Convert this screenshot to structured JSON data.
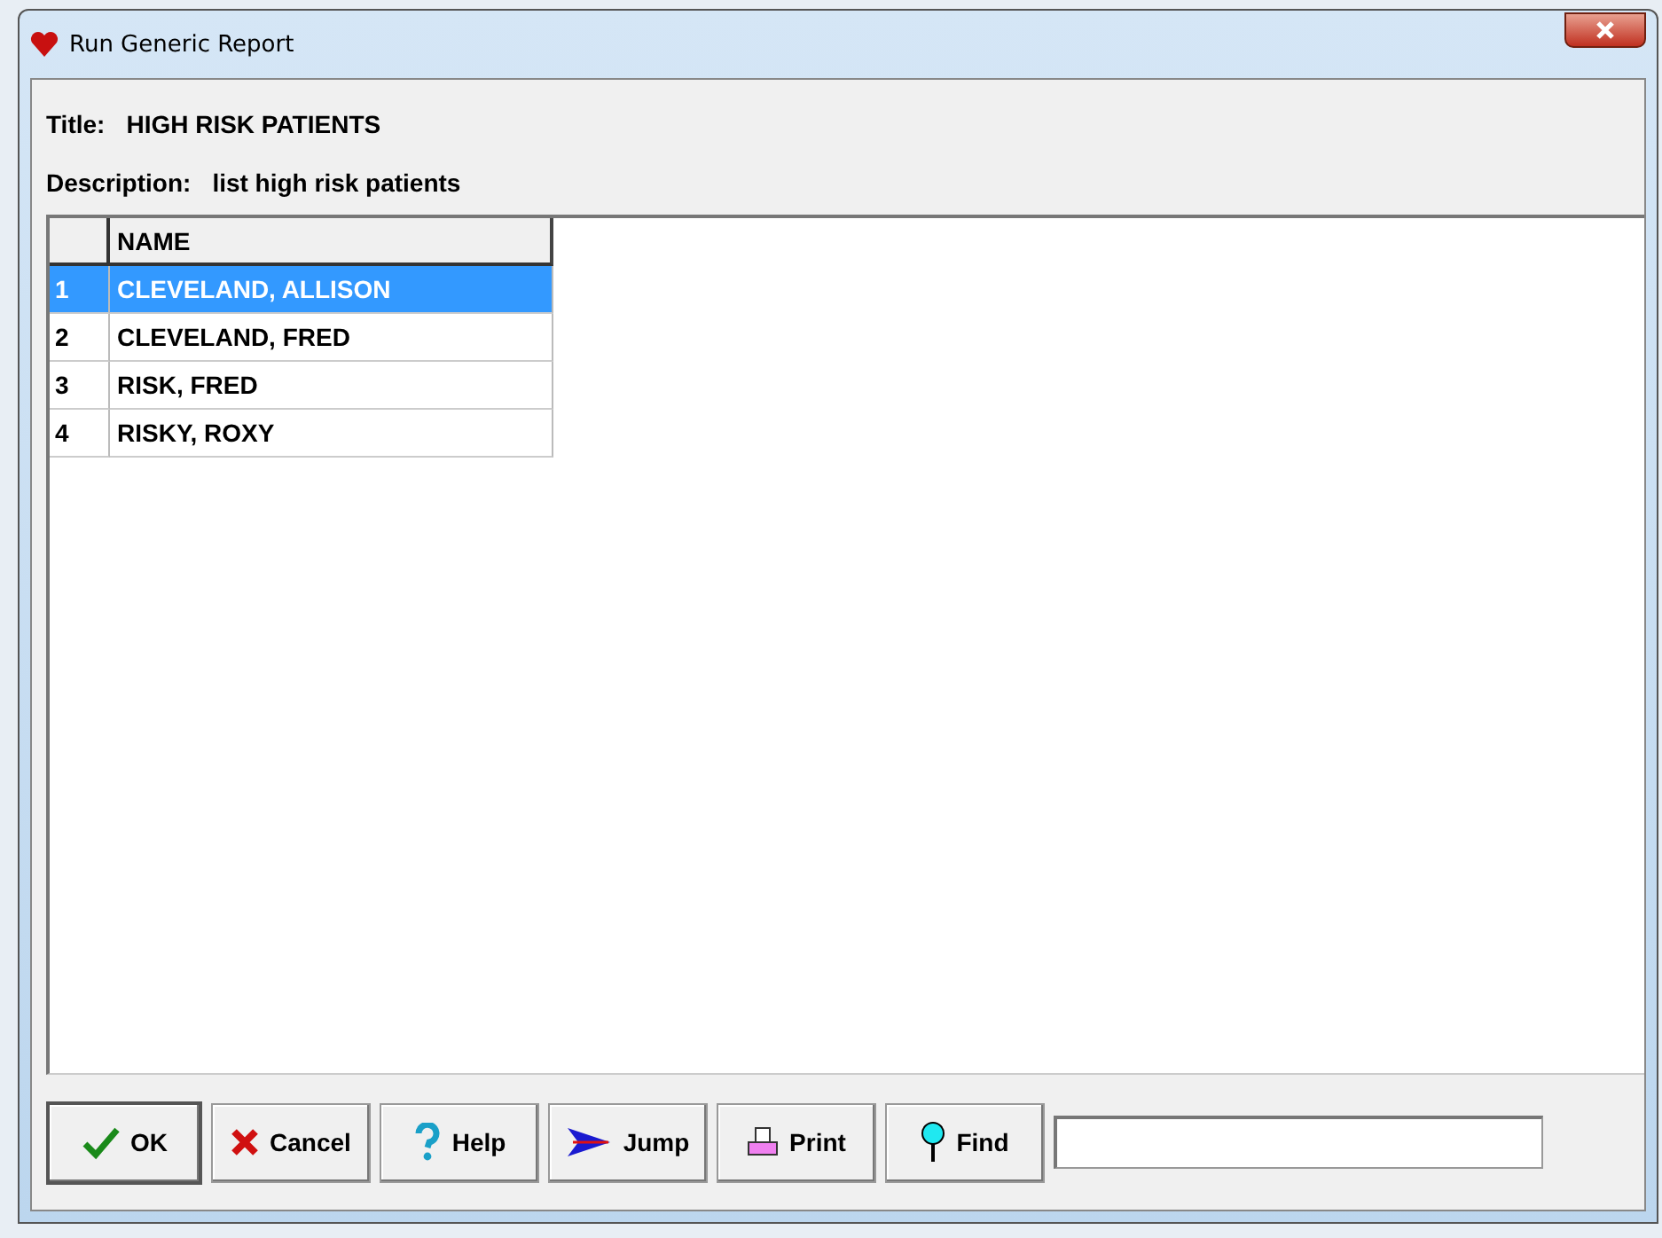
{
  "window": {
    "title": "Run Generic Report"
  },
  "title_label": "Title:",
  "title_value": "HIGH RISK PATIENTS",
  "description_label": "Description:",
  "description_value": "list high risk patients",
  "table": {
    "columns": [
      "NAME"
    ],
    "rows": [
      {
        "number": "1",
        "name": "CLEVELAND, ALLISON",
        "selected": true
      },
      {
        "number": "2",
        "name": "CLEVELAND, FRED",
        "selected": false
      },
      {
        "number": "3",
        "name": "RISK, FRED",
        "selected": false
      },
      {
        "number": "4",
        "name": "RISKY, ROXY",
        "selected": false
      }
    ]
  },
  "buttons": [
    {
      "kind": "ok",
      "label": "OK"
    },
    {
      "kind": "cancel",
      "label": "Cancel"
    },
    {
      "kind": "help",
      "label": "Help"
    },
    {
      "kind": "jump",
      "label": "Jump"
    },
    {
      "kind": "print",
      "label": "Print"
    },
    {
      "kind": "find",
      "label": "Find"
    }
  ]
}
